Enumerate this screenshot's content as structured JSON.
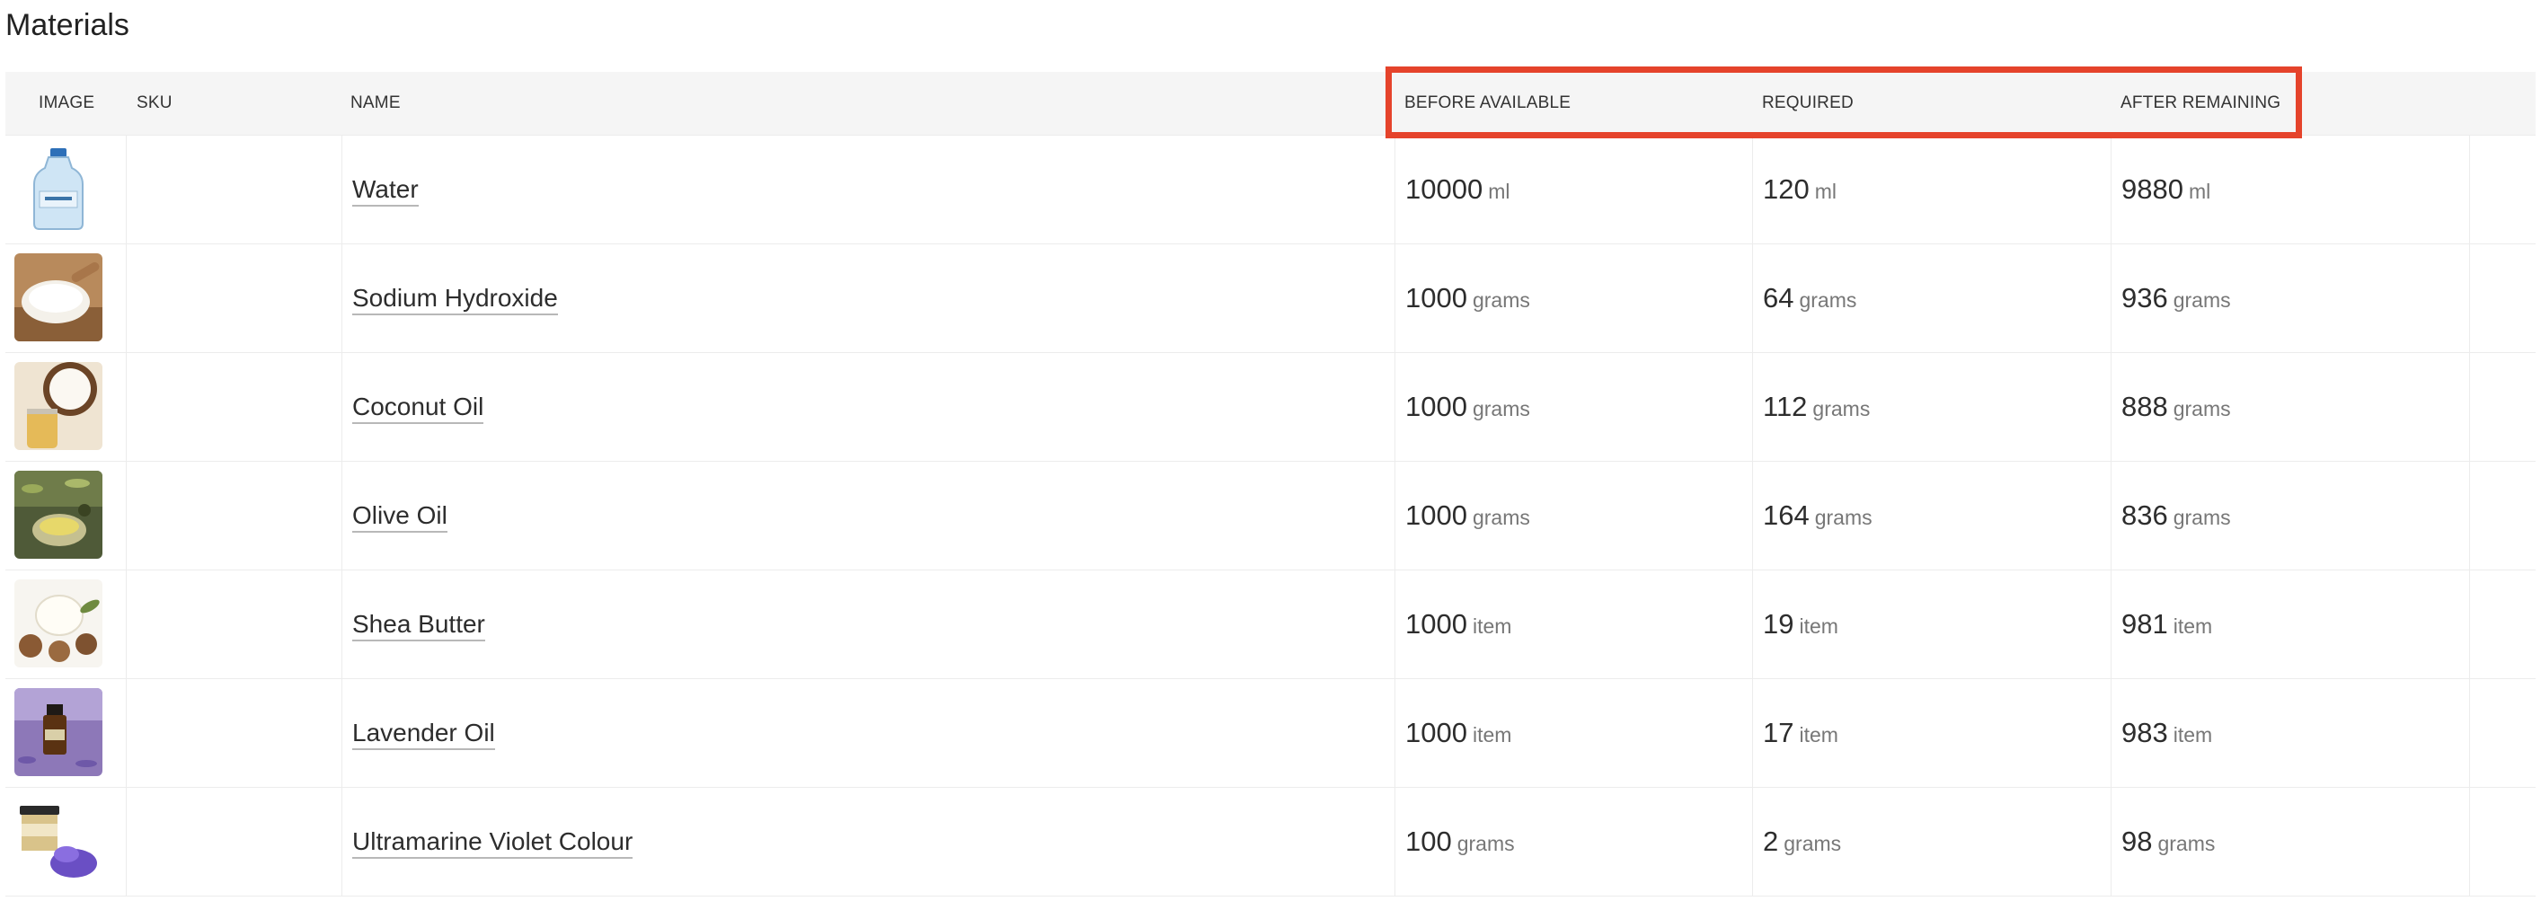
{
  "page": {
    "title": "Materials"
  },
  "table": {
    "headers": {
      "image": "IMAGE",
      "sku": "SKU",
      "name": "NAME",
      "before": "BEFORE AVAILABLE",
      "required": "REQUIRED",
      "after": "AFTER REMAINING"
    },
    "rows": [
      {
        "image_icon": "water-bottle-image",
        "sku": "",
        "name": "Water",
        "before": "10000",
        "before_unit": "ml",
        "required": "120",
        "required_unit": "ml",
        "after": "9880",
        "after_unit": "ml"
      },
      {
        "image_icon": "sodium-hydroxide-image",
        "sku": "",
        "name": "Sodium Hydroxide",
        "before": "1000",
        "before_unit": "grams",
        "required": "64",
        "required_unit": "grams",
        "after": "936",
        "after_unit": "grams"
      },
      {
        "image_icon": "coconut-oil-image",
        "sku": "",
        "name": "Coconut Oil",
        "before": "1000",
        "before_unit": "grams",
        "required": "112",
        "required_unit": "grams",
        "after": "888",
        "after_unit": "grams"
      },
      {
        "image_icon": "olive-oil-image",
        "sku": "",
        "name": "Olive Oil",
        "before": "1000",
        "before_unit": "grams",
        "required": "164",
        "required_unit": "grams",
        "after": "836",
        "after_unit": "grams"
      },
      {
        "image_icon": "shea-butter-image",
        "sku": "",
        "name": "Shea Butter",
        "before": "1000",
        "before_unit": "item",
        "required": "19",
        "required_unit": "item",
        "after": "981",
        "after_unit": "item"
      },
      {
        "image_icon": "lavender-oil-image",
        "sku": "",
        "name": "Lavender Oil",
        "before": "1000",
        "before_unit": "item",
        "required": "17",
        "required_unit": "item",
        "after": "983",
        "after_unit": "item"
      },
      {
        "image_icon": "ultramarine-violet-image",
        "sku": "",
        "name": "Ultramarine Violet Colour",
        "before": "100",
        "before_unit": "grams",
        "required": "2",
        "required_unit": "grams",
        "after": "98",
        "after_unit": "grams"
      }
    ]
  },
  "colors": {
    "highlight_border": "#e5432b",
    "header_bg": "#f5f5f5",
    "row_border": "#ececec",
    "unit_text": "#777777"
  }
}
